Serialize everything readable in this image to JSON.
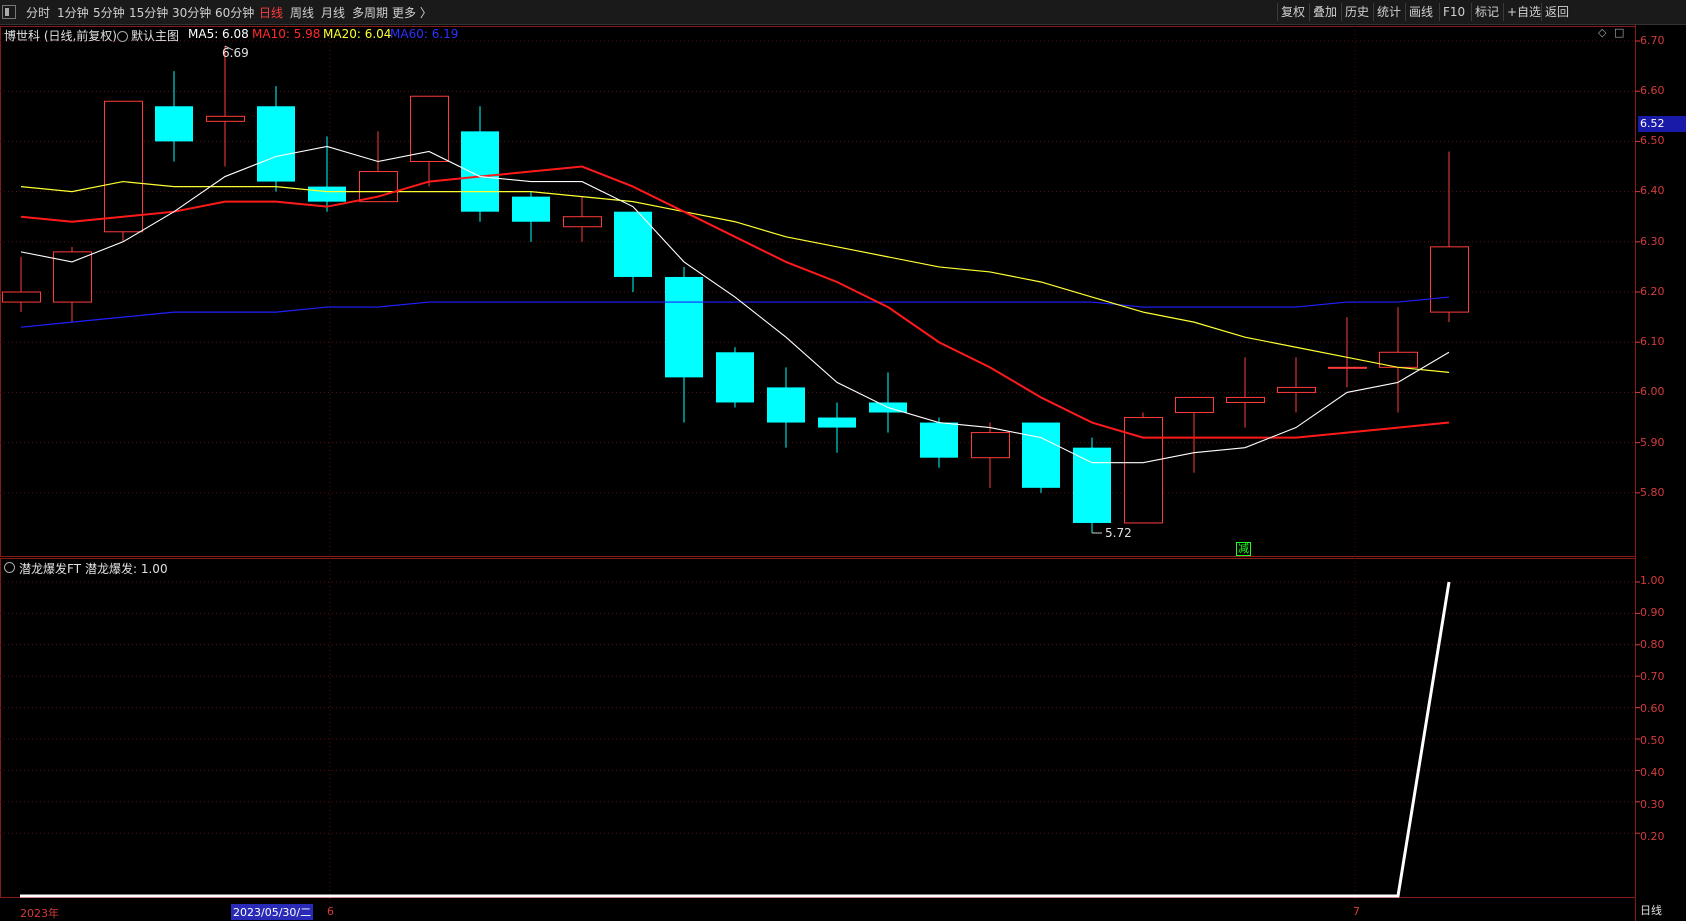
{
  "toolbar": {
    "periods": [
      "分时",
      "1分钟",
      "5分钟",
      "15分钟",
      "30分钟",
      "60分钟",
      "日线",
      "周线",
      "月线",
      "多周期",
      "更多 〉"
    ],
    "active_period": "日线",
    "right_buttons": [
      "复权",
      "叠加",
      "历史",
      "统计",
      "画线",
      "F10",
      "+自选",
      "返回"
    ],
    "mark_label": "标记"
  },
  "main_panel": {
    "stock_title": "博世科 (日线,前复权)",
    "indicator_name": "默认主图",
    "ma5": "MA5: 6.08",
    "ma10": "MA10: 5.98",
    "ma20": "MA20: 6.04",
    "ma60": "MA60: 6.19",
    "high_label": "6.69",
    "low_label": "5.72",
    "current_price": "6.52",
    "signal_label": "减",
    "y_ticks": [
      "6.70",
      "6.60",
      "6.50",
      "6.40",
      "6.30",
      "6.20",
      "6.10",
      "6.00",
      "5.90",
      "5.80"
    ]
  },
  "sub_panel": {
    "indicator_name": "潜龙爆发FT",
    "value_text": "潜龙爆发: 1.00",
    "y_ticks": [
      "1.00",
      "0.90",
      "0.80",
      "0.70",
      "0.60",
      "0.50",
      "0.40",
      "0.30",
      "0.20"
    ],
    "period_button": "日线"
  },
  "x_axis": {
    "year_label": "2023年",
    "cursor_date": "2023/05/30/二",
    "month6": "6",
    "month7": "7"
  },
  "colors": {
    "up": "#ff3b3b",
    "down": "#00ffff",
    "ma5": "#ffffff",
    "ma10": "#ff1a1a",
    "ma20": "#ffff33",
    "ma60": "#2020ff",
    "grid": "#5a1010"
  },
  "chart_data": {
    "type": "candlestick",
    "y_range": [
      5.7,
      6.72
    ],
    "candles": [
      {
        "o": 6.18,
        "h": 6.27,
        "l": 6.16,
        "c": 6.2
      },
      {
        "o": 6.18,
        "h": 6.29,
        "l": 6.14,
        "c": 6.28
      },
      {
        "o": 6.32,
        "h": 6.58,
        "l": 6.3,
        "c": 6.58
      },
      {
        "o": 6.57,
        "h": 6.64,
        "l": 6.46,
        "c": 6.5
      },
      {
        "o": 6.54,
        "h": 6.69,
        "l": 6.45,
        "c": 6.55
      },
      {
        "o": 6.57,
        "h": 6.61,
        "l": 6.4,
        "c": 6.42
      },
      {
        "o": 6.41,
        "h": 6.51,
        "l": 6.36,
        "c": 6.38
      },
      {
        "o": 6.38,
        "h": 6.52,
        "l": 6.38,
        "c": 6.44
      },
      {
        "o": 6.46,
        "h": 6.59,
        "l": 6.41,
        "c": 6.59
      },
      {
        "o": 6.52,
        "h": 6.57,
        "l": 6.34,
        "c": 6.36
      },
      {
        "o": 6.39,
        "h": 6.4,
        "l": 6.3,
        "c": 6.34
      },
      {
        "o": 6.33,
        "h": 6.39,
        "l": 6.3,
        "c": 6.35
      },
      {
        "o": 6.36,
        "h": 6.36,
        "l": 6.2,
        "c": 6.23
      },
      {
        "o": 6.23,
        "h": 6.25,
        "l": 5.94,
        "c": 6.03
      },
      {
        "o": 6.08,
        "h": 6.09,
        "l": 5.97,
        "c": 5.98
      },
      {
        "o": 6.01,
        "h": 6.05,
        "l": 5.89,
        "c": 5.94
      },
      {
        "o": 5.95,
        "h": 5.98,
        "l": 5.88,
        "c": 5.93
      },
      {
        "o": 5.98,
        "h": 6.04,
        "l": 5.92,
        "c": 5.96
      },
      {
        "o": 5.94,
        "h": 5.95,
        "l": 5.85,
        "c": 5.87
      },
      {
        "o": 5.87,
        "h": 5.94,
        "l": 5.81,
        "c": 5.92
      },
      {
        "o": 5.94,
        "h": 5.94,
        "l": 5.8,
        "c": 5.81
      },
      {
        "o": 5.89,
        "h": 5.91,
        "l": 5.72,
        "c": 5.74
      },
      {
        "o": 5.74,
        "h": 5.96,
        "l": 5.74,
        "c": 5.95
      },
      {
        "o": 5.96,
        "h": 5.99,
        "l": 5.84,
        "c": 5.99
      },
      {
        "o": 5.98,
        "h": 6.07,
        "l": 5.93,
        "c": 5.99
      },
      {
        "o": 6.0,
        "h": 6.07,
        "l": 5.96,
        "c": 6.01
      },
      {
        "o": 6.05,
        "h": 6.15,
        "l": 6.01,
        "c": 6.05
      },
      {
        "o": 6.05,
        "h": 6.17,
        "l": 5.96,
        "c": 6.08
      },
      {
        "o": 6.16,
        "h": 6.48,
        "l": 6.14,
        "c": 6.29
      }
    ],
    "ma5": [
      6.28,
      6.26,
      6.3,
      6.36,
      6.43,
      6.47,
      6.49,
      6.46,
      6.48,
      6.43,
      6.42,
      6.42,
      6.37,
      6.26,
      6.19,
      6.11,
      6.02,
      5.97,
      5.94,
      5.93,
      5.91,
      5.86,
      5.86,
      5.88,
      5.89,
      5.93,
      6.0,
      6.02,
      6.08
    ],
    "ma10": [
      6.35,
      6.34,
      6.35,
      6.36,
      6.38,
      6.38,
      6.37,
      6.39,
      6.42,
      6.43,
      6.44,
      6.45,
      6.41,
      6.36,
      6.31,
      6.26,
      6.22,
      6.17,
      6.1,
      6.05,
      5.99,
      5.94,
      5.91,
      5.91,
      5.91,
      5.91,
      5.92,
      5.93,
      5.94,
      5.98
    ],
    "ma20": [
      6.41,
      6.4,
      6.42,
      6.41,
      6.41,
      6.41,
      6.4,
      6.4,
      6.4,
      6.4,
      6.4,
      6.39,
      6.38,
      6.36,
      6.34,
      6.31,
      6.29,
      6.27,
      6.25,
      6.24,
      6.22,
      6.19,
      6.16,
      6.14,
      6.11,
      6.09,
      6.07,
      6.05,
      6.04
    ],
    "ma60": [
      6.13,
      6.14,
      6.15,
      6.16,
      6.16,
      6.16,
      6.17,
      6.17,
      6.18,
      6.18,
      6.18,
      6.18,
      6.18,
      6.18,
      6.18,
      6.18,
      6.18,
      6.18,
      6.18,
      6.18,
      6.18,
      6.18,
      6.17,
      6.17,
      6.17,
      6.17,
      6.18,
      6.18,
      6.19
    ],
    "sub_values": [
      0,
      0,
      0,
      0,
      0,
      0,
      0,
      0,
      0,
      0,
      0,
      0,
      0,
      0,
      0,
      0,
      0,
      0,
      0,
      0,
      0,
      0,
      0,
      0,
      0,
      0,
      0,
      0,
      1.0
    ],
    "sub_range": [
      0,
      1.05
    ]
  }
}
